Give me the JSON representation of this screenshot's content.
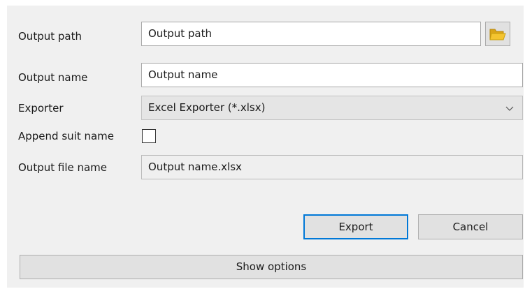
{
  "form": {
    "output_path": {
      "label": "Output path",
      "value": "Output path"
    },
    "output_name": {
      "label": "Output name",
      "value": "Output name"
    },
    "exporter": {
      "label": "Exporter",
      "selected": "Excel Exporter (*.xlsx)"
    },
    "append_suit_name": {
      "label": "Append suit name",
      "checked": false
    },
    "output_file_name": {
      "label": "Output file name",
      "value": "Output name.xlsx"
    }
  },
  "buttons": {
    "export": "Export",
    "cancel": "Cancel",
    "show_options": "Show options"
  },
  "icons": {
    "browse": "folder-icon",
    "dropdown": "chevron-down-icon"
  },
  "colors": {
    "folder": "#f4c430",
    "default_button_border": "#0078d7"
  }
}
